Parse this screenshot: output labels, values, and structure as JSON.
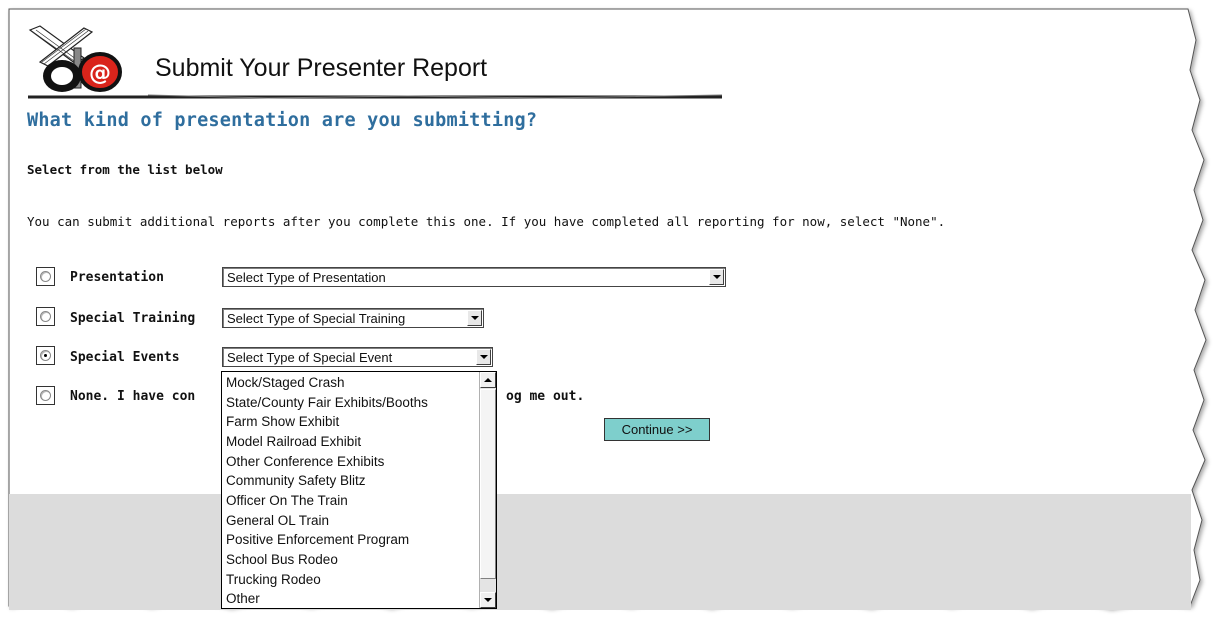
{
  "header": {
    "title": "Submit Your Presenter Report",
    "logo_icon": "operation-lifesaver-at-logo-icon"
  },
  "question": "What kind of presentation are you submitting?",
  "subhead": "Select from the list below",
  "instruction": "You can submit additional reports after you complete this one. If you have completed all reporting for now, select \"None\".",
  "rows": [
    {
      "label": "Presentation",
      "select_value": "Select Type of Presentation",
      "checked": false
    },
    {
      "label": "Special Training",
      "select_value": "Select Type of Special Training",
      "checked": false
    },
    {
      "label": "Special Events",
      "select_value": "Select Type of Special Event",
      "checked": true
    },
    {
      "label_before": "None.  I have con",
      "label_after": "og me out.",
      "checked": false
    }
  ],
  "dropdown_options": [
    "Mock/Staged Crash",
    "State/County Fair Exhibits/Booths",
    "Farm Show Exhibit",
    "Model Railroad Exhibit",
    "Other Conference Exhibits",
    "Community Safety Blitz",
    "Officer On The Train",
    "General OL Train",
    "Positive Enforcement Program",
    "School Bus Rodeo",
    "Trucking Rodeo",
    "Other"
  ],
  "continue_label": "Continue >>",
  "colors": {
    "question_text": "#2f6e9e",
    "continue_bg": "#7ecfcc",
    "logo_red": "#d9241b",
    "footer_band": "#dcdcdc"
  }
}
